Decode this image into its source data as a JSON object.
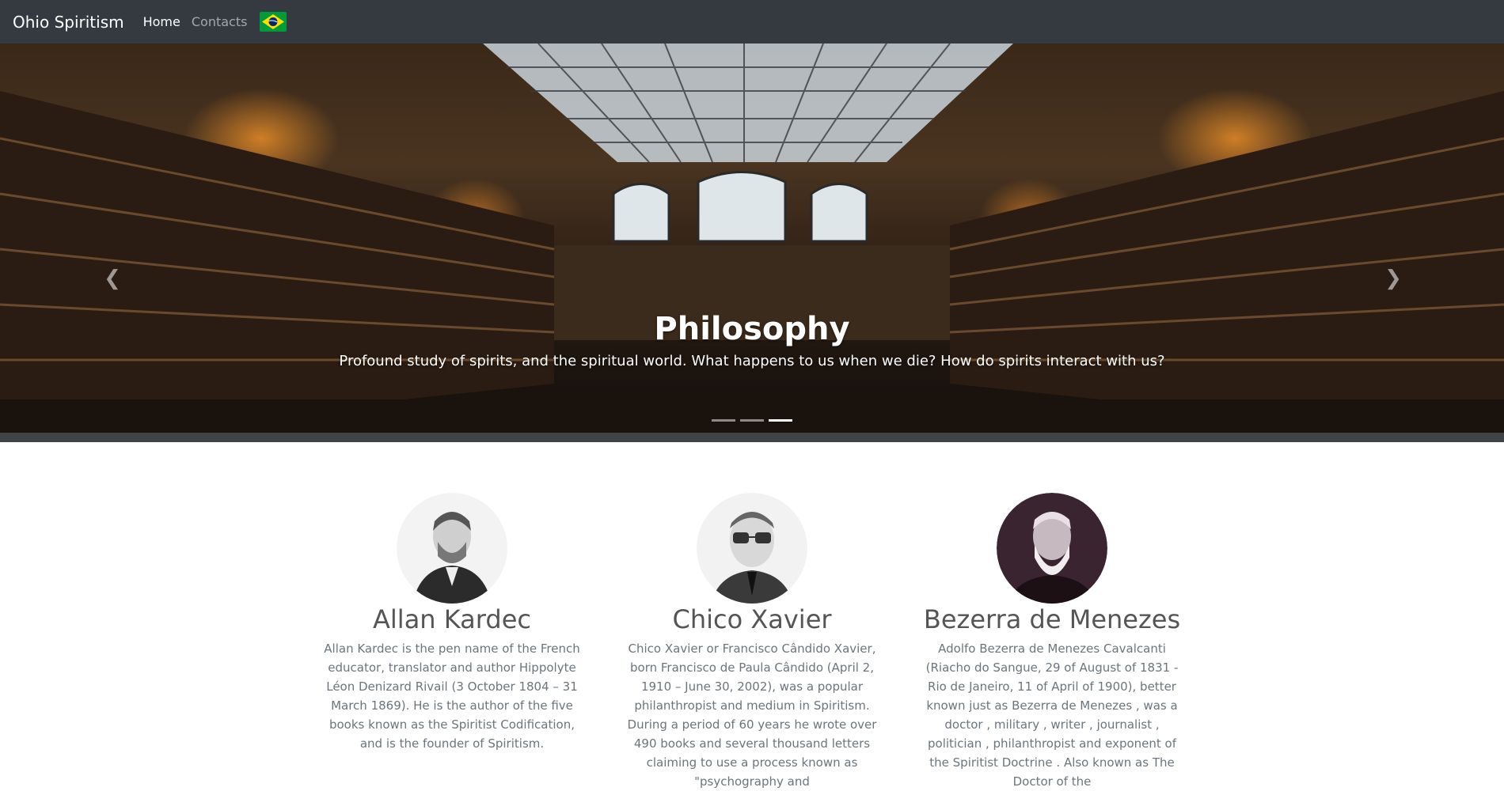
{
  "nav": {
    "brand": "Ohio Spiritism",
    "links": [
      "Home",
      "Contacts"
    ],
    "flag_icon": "brazil-flag-icon"
  },
  "carousel": {
    "title": "Philosophy",
    "text": "Profound study of spirits, and the spiritual world. What happens to us when we die? How do spirits interact with us?",
    "prev_icon": "chevron-left-icon",
    "next_icon": "chevron-right-icon",
    "indicator_count": 3,
    "active_indicator": 3
  },
  "people": [
    {
      "name": "Allan Kardec",
      "bio": "Allan Kardec is the pen name of the French educator, translator and author Hippolyte Léon Denizard Rivail (3 October 1804 – 31 March 1869). He is the author of the five books known as the Spiritist Codification, and is the founder of Spiritism."
    },
    {
      "name": "Chico Xavier",
      "bio": "Chico Xavier or Francisco Cândido Xavier, born Francisco de Paula Cândido (April 2, 1910 – June 30, 2002), was a popular philanthropist and medium in Spiritism. During a period of 60 years he wrote over 490 books and several thousand letters claiming to use a process known as \"psychography and"
    },
    {
      "name": "Bezerra de Menezes",
      "bio": "Adolfo Bezerra de Menezes Cavalcanti (Riacho do Sangue, 29 of August of 1831 - Rio de Janeiro, 11 of April of 1900), better known just as Bezerra de Menezes , was a doctor , military , writer , journalist , politician , philanthropist and exponent of the Spiritist Doctrine . Also known as The Doctor of the"
    }
  ],
  "colors": {
    "navbar": "#343a40",
    "heading": "#555555",
    "body_text": "#6c757d"
  }
}
